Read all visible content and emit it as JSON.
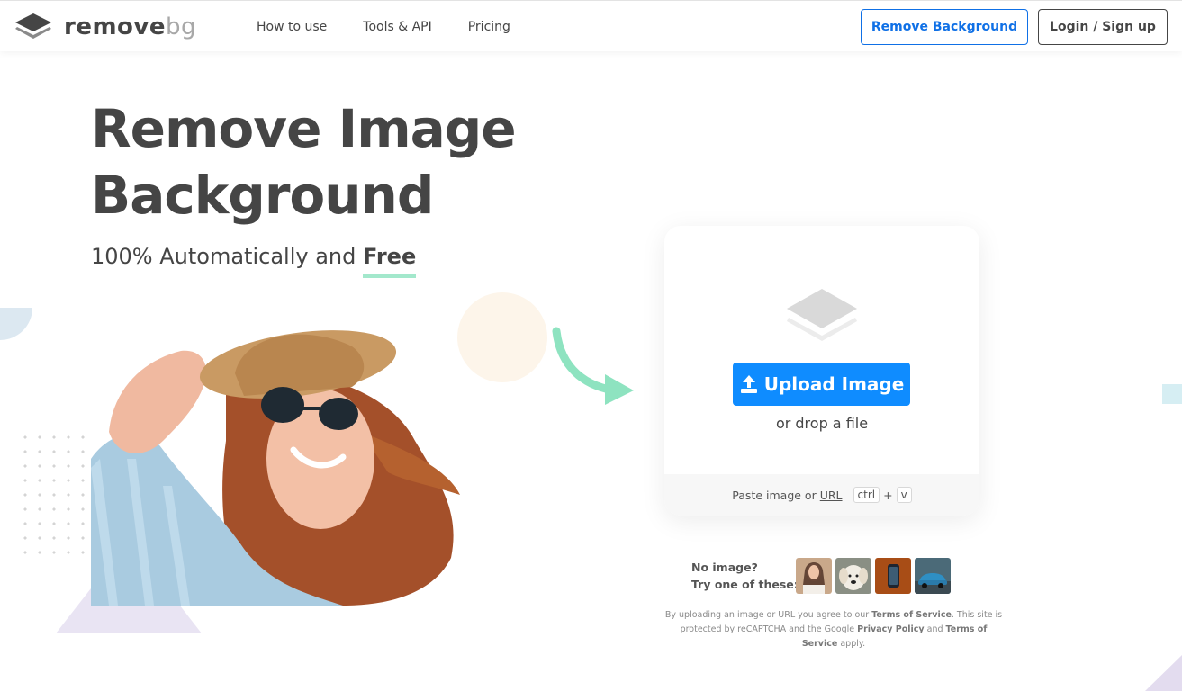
{
  "header": {
    "logo": {
      "text_main": "remove",
      "text_accent": "bg"
    },
    "nav": [
      {
        "label": "How to use"
      },
      {
        "label": "Tools & API"
      },
      {
        "label": "Pricing"
      }
    ],
    "cta_remove_background": "Remove Background",
    "cta_login": "Login / Sign up"
  },
  "hero": {
    "title_line1": "Remove Image",
    "title_line2": "Background",
    "subtitle_prefix": "100% Automatically and ",
    "subtitle_highlight": "Free"
  },
  "upload": {
    "button_label": "Upload Image",
    "drop_text": "or drop a file",
    "paste_prefix": "Paste image or",
    "paste_link": "URL",
    "key_ctrl": "ctrl",
    "key_plus": "+",
    "key_v": "v"
  },
  "samples": {
    "line1": "No image?",
    "line2": "Try one of these:",
    "thumbnails": [
      "woman-portrait",
      "dog",
      "phone",
      "car"
    ]
  },
  "legal": {
    "part1": "By uploading an image or URL you agree to our ",
    "terms1": "Terms of Service",
    "part2": ". This site is protected by reCAPTCHA and the Google ",
    "privacy": "Privacy Policy",
    "part3": " and ",
    "terms2": "Terms of Service",
    "part4": " apply."
  },
  "colors": {
    "primary_blue": "#0f8cff",
    "text_dark": "#454545",
    "accent_green": "#a3e8cc",
    "arrow_green": "#8ee3c0"
  }
}
